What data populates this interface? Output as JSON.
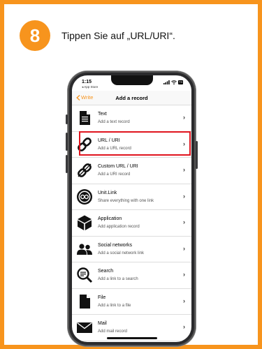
{
  "step": {
    "number": "8",
    "instruction": "Tippen Sie auf „URL/URI“."
  },
  "colors": {
    "accent": "#f7941d",
    "highlight": "#e0141e"
  },
  "status_bar": {
    "time": "1:15",
    "back_app": "◂ App Store",
    "battery": "74"
  },
  "nav": {
    "back_label": "Write",
    "title": "Add a record"
  },
  "records": [
    {
      "title": "Text",
      "subtitle": "Add a text record",
      "icon": "document-icon"
    },
    {
      "title": "URL / URI",
      "subtitle": "Add a URL record",
      "icon": "link-icon",
      "highlighted": true
    },
    {
      "title": "Custom URL / URI",
      "subtitle": "Add a URI record",
      "icon": "custom-link-icon"
    },
    {
      "title": "Unit.Link",
      "subtitle": "Share everything with one link",
      "icon": "unit-link-icon"
    },
    {
      "title": "Application",
      "subtitle": "Add application record",
      "icon": "cube-icon"
    },
    {
      "title": "Social networks",
      "subtitle": "Add a social network link",
      "icon": "people-icon"
    },
    {
      "title": "Search",
      "subtitle": "Add a link to a search",
      "icon": "search-icon"
    },
    {
      "title": "File",
      "subtitle": "Add a link to a file",
      "icon": "file-icon"
    },
    {
      "title": "Mail",
      "subtitle": "Add mail record",
      "icon": "mail-icon"
    }
  ]
}
